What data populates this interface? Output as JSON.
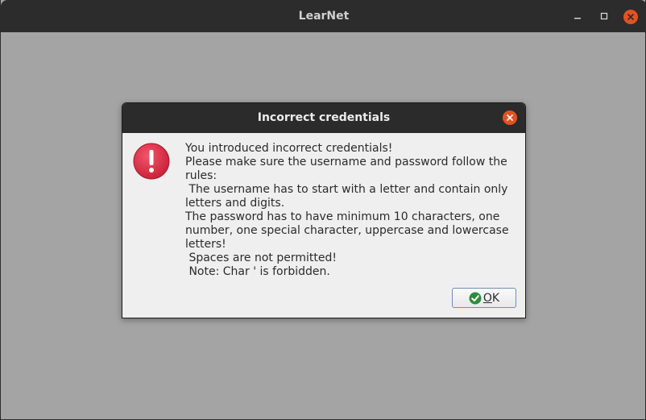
{
  "window": {
    "title": "LearNet",
    "controls": {
      "minimize_icon": "minimize-icon",
      "maximize_icon": "maximize-icon",
      "close_icon": "close-icon"
    },
    "colors": {
      "background": "#a4a4a4",
      "titlebar": "#2c2c2c",
      "close_accent": "#e45222"
    }
  },
  "dialog": {
    "title": "Incorrect credentials",
    "icon": "error-icon",
    "message_lines": [
      "You introduced incorrect credentials!",
      "Please make sure the username and password follow the rules:",
      " The username has to start with a letter and contain only letters and digits.",
      "The password has to have minimum 10 characters, one number, one special character, uppercase and lowercase letters!",
      " Spaces are not permitted!",
      " Note: Char ' is forbidden."
    ],
    "ok_button": {
      "label_mnemonic": "O",
      "label_rest": "K",
      "icon": "check-icon"
    },
    "colors": {
      "error_red": "#d8263e",
      "ok_green": "#2e8b3a"
    }
  }
}
